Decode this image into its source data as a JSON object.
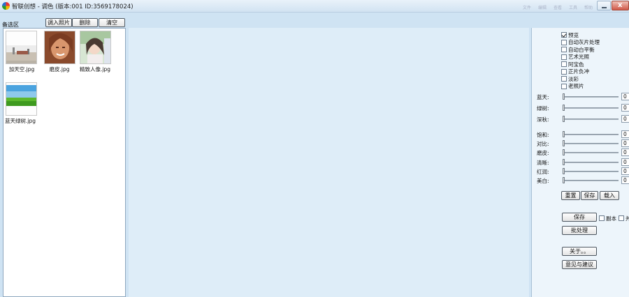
{
  "window": {
    "title": "智联创想 - 调色 (版本:001  ID:3569178024)",
    "faint_menu": [
      "文件",
      "编辑",
      "查看",
      "工具",
      "帮助"
    ]
  },
  "candidate_area": {
    "label": "备选区",
    "buttons": {
      "import": "调入照片",
      "delete": "删除",
      "clear": "清空"
    },
    "thumbnails": [
      {
        "name": "加天空.jpg"
      },
      {
        "name": "磨皮.jpg"
      },
      {
        "name": "精致人像.jpg"
      },
      {
        "name": "蓝天绿树.jpg"
      }
    ]
  },
  "options": [
    {
      "label": "预览",
      "checked": true
    },
    {
      "label": "自动灰片处理",
      "checked": false
    },
    {
      "label": "自动白平衡",
      "checked": false
    },
    {
      "label": "艺术光照",
      "checked": false
    },
    {
      "label": "阿宝色",
      "checked": false
    },
    {
      "label": "正片负冲",
      "checked": false
    },
    {
      "label": "淡彩",
      "checked": false
    },
    {
      "label": "老照片",
      "checked": false
    }
  ],
  "sliders": [
    {
      "label": "蓝天:",
      "value": "0"
    },
    {
      "label": "绿树:",
      "value": "0"
    },
    {
      "label": "深秋:",
      "value": "0"
    },
    {
      "label": "饱和:",
      "value": "0"
    },
    {
      "label": "对比:",
      "value": "0"
    },
    {
      "label": "磨皮:",
      "value": "0"
    },
    {
      "label": "清晰:",
      "value": "0"
    },
    {
      "label": "红润:",
      "value": "0"
    },
    {
      "label": "美白:",
      "value": "0"
    }
  ],
  "preset_buttons": {
    "reset": "重置",
    "save": "保存",
    "load": "载入"
  },
  "actions": {
    "save": "保存",
    "copy_label": "副本",
    "overlay_label": "并",
    "batch": "批处理",
    "about": "关于。。",
    "feedback": "意见与建议"
  }
}
